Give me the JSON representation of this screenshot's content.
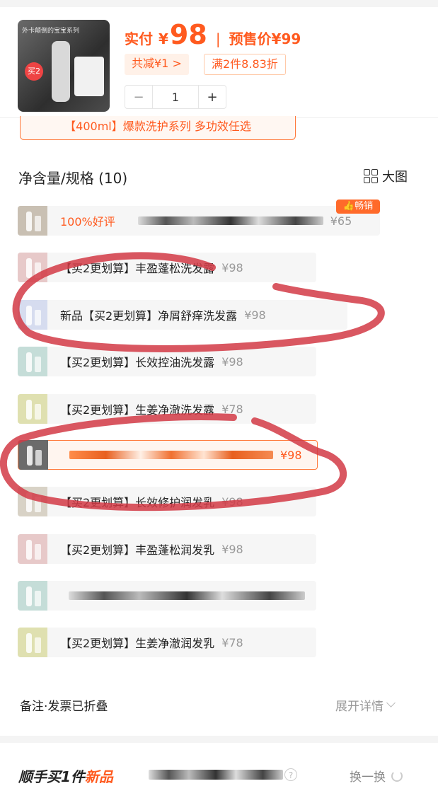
{
  "product": {
    "thumb_title": "外卡颠倒的宝宝系列",
    "thumb_tag": "买2"
  },
  "price": {
    "label": "实付",
    "currency": "¥",
    "value": "98",
    "original": "预售价¥99"
  },
  "promos": {
    "discount": "共减¥1 >",
    "deal": "满2件8.83折"
  },
  "stepper": {
    "minus": "−",
    "qty": "1",
    "plus": "+"
  },
  "series_banner": "【400ml】爆款洗护系列 多功效任选",
  "specs": {
    "header": "净含量/规格 (10)",
    "big_image": "大图",
    "hot_badge": "畅销",
    "options": [
      {
        "label": "100%好评",
        "price": "¥65",
        "color": "#c9c0b3"
      },
      {
        "label": "【买2更划算】丰盈蓬松洗发露",
        "price": "¥98",
        "color": "#e7c9c9"
      },
      {
        "label": "新品【买2更划算】净屑舒痒洗发露",
        "price": "¥98",
        "color": "#d6dcef"
      },
      {
        "label": "【买2更划算】长效控油洗发露",
        "price": "¥98",
        "color": "#c5ddd8"
      },
      {
        "label": "【买2更划算】生姜净澈洗发露",
        "price": "¥78",
        "color": "#dfe0b0"
      },
      {
        "label": "",
        "price": "¥98",
        "color": "#6b6b6b"
      },
      {
        "label": "【买2更划算】长效修护润发乳",
        "price": "¥98",
        "color": "#d8d2c6"
      },
      {
        "label": "【买2更划算】丰盈蓬松润发乳",
        "price": "¥98",
        "color": "#e7c9c9"
      },
      {
        "label": "",
        "price": "",
        "color": "#c5ddd8"
      },
      {
        "label": "【买2更划算】生姜净澈润发乳",
        "price": "¥78",
        "color": "#dfe0b0"
      }
    ]
  },
  "remark": {
    "label": "备注·发票已折叠",
    "expand": "展开详情"
  },
  "addon": {
    "title_prefix": "顺手买1件",
    "title_new": "新品",
    "help": "?",
    "swap": "换一换"
  },
  "colors": {
    "accent": "#ff5a1f",
    "annotation_red": "#d23a45"
  }
}
